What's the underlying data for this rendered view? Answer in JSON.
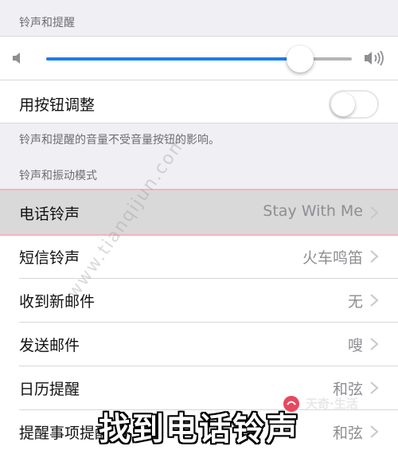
{
  "sections": {
    "ringer_header": "铃声和提醒",
    "sounds_header": "铃声和振动模式"
  },
  "volume": {
    "level": 0.83,
    "low_icon": "speaker-low-icon",
    "high_icon": "speaker-high-icon"
  },
  "toggle": {
    "label": "用按钮调整",
    "on": false
  },
  "note": "铃声和提醒的音量不受音量按钮的影响。",
  "rows": [
    {
      "label": "电话铃声",
      "value": "Stay With Me"
    },
    {
      "label": "短信铃声",
      "value": "火车鸣笛"
    },
    {
      "label": "收到新邮件",
      "value": "无"
    },
    {
      "label": "发送邮件",
      "value": "嗖"
    },
    {
      "label": "日历提醒",
      "value": "和弦"
    },
    {
      "label": "提醒事项提醒",
      "value": "和弦"
    }
  ],
  "watermark": "www.tianqijun.com",
  "logo": {
    "text": "天奇·生活"
  },
  "caption": "找到电话铃声",
  "colors": {
    "accent": "#1b7cf2",
    "highlight_border": "#f4b4bf"
  }
}
